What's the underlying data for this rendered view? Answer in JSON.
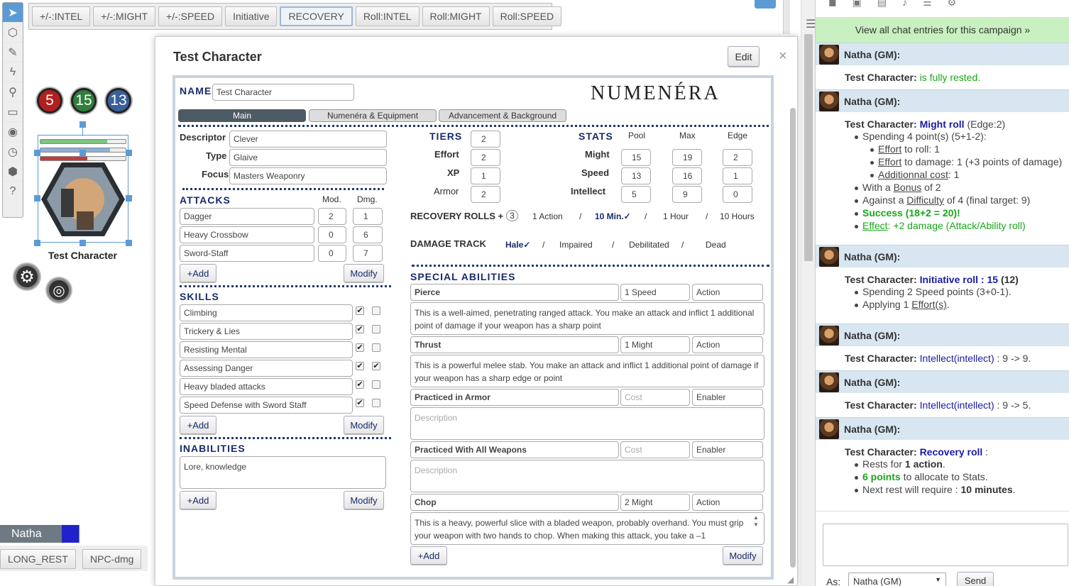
{
  "macros": [
    "+/-:INTEL",
    "+/-:MIGHT",
    "+/-:SPEED",
    "Initiative",
    "RECOVERY",
    "Roll:INTEL",
    "Roll:MIGHT",
    "Roll:SPEED"
  ],
  "token": {
    "bubble1": "5",
    "bubble2": "15",
    "bubble3": "13",
    "name": "Test Character",
    "bar1_fill": 0.78,
    "bar2_fill": 0.82,
    "bar3_fill": 0.55,
    "bar1_color": "#7fc47f",
    "bar2_color": "#8cb0d8",
    "bar3_color": "#c33c3c"
  },
  "player": {
    "name": "Natha",
    "color": "#2222cc"
  },
  "bottom_macros": [
    "LONG_REST",
    "NPC-dmg"
  ],
  "sheet": {
    "title": "Test Character",
    "edit": "Edit",
    "close": "×",
    "logo": "NUMENÉRA",
    "name_label": "NAME",
    "name_value": "Test Character",
    "tabs": [
      "Main",
      "Numenéra & Equipment",
      "Advancement & Background"
    ],
    "descriptor_label": "Descriptor",
    "descriptor": "Clever",
    "type_label": "Type",
    "type": "Glaive",
    "focus_label": "Focus",
    "focus": "Masters Weaponry",
    "tiers_label": "TIERS",
    "tiers": "2",
    "effort_label": "Effort",
    "effort": "2",
    "xp_label": "XP",
    "xp": "1",
    "armor_label": "Armor",
    "armor": "2",
    "stats_label": "STATS",
    "pool_label": "Pool",
    "max_label": "Max",
    "edge_label": "Edge",
    "might_label": "Might",
    "might": {
      "pool": "15",
      "max": "19",
      "edge": "2"
    },
    "speed_label": "Speed",
    "speed": {
      "pool": "13",
      "max": "16",
      "edge": "1"
    },
    "intellect_label": "Intellect",
    "intellect": {
      "pool": "5",
      "max": "9",
      "edge": "0"
    },
    "attacks_label": "ATTACKS",
    "mod_label": "Mod.",
    "dmg_label": "Dmg.",
    "attacks": [
      {
        "name": "Dagger",
        "mod": "2",
        "dmg": "1"
      },
      {
        "name": "Heavy Crossbow",
        "mod": "0",
        "dmg": "6"
      },
      {
        "name": "Sword-Staff",
        "mod": "0",
        "dmg": "7"
      }
    ],
    "add_label": "+Add",
    "modify_label": "Modify",
    "skills_label": "SKILLS",
    "skills": [
      {
        "name": "Climbing",
        "trained": "✔",
        "specialized": ""
      },
      {
        "name": "Trickery & Lies",
        "trained": "✔",
        "specialized": ""
      },
      {
        "name": "Resisting Mental",
        "trained": "✔",
        "specialized": ""
      },
      {
        "name": "Assessing Danger",
        "trained": "✔",
        "specialized": "✔"
      },
      {
        "name": "Heavy bladed attacks",
        "trained": "✔",
        "specialized": ""
      },
      {
        "name": "Speed Defense with Sword Staff",
        "trained": "✔",
        "specialized": ""
      }
    ],
    "inabilities_label": "INABILITIES",
    "inabilities": "Lore, knowledge",
    "recovery_label": "RECOVERY ROLLS +",
    "recovery_bonus": "3",
    "recovery": [
      "1 Action",
      "/",
      "10 Min.✓",
      "/",
      "1 Hour",
      "/",
      "10 Hours"
    ],
    "damage_label": "DAMAGE TRACK",
    "damage": [
      "Hale✓",
      "/",
      "Impaired",
      "/",
      "Debilitated",
      "/",
      "Dead"
    ],
    "special_label": "SPECIAL ABILITIES",
    "abilities": [
      {
        "name": "Pierce",
        "cost": "1 Speed",
        "type": "Action",
        "desc": "This is a well-aimed, penetrating ranged attack. You make an attack and inflict 1 additional point of damage if your weapon has a sharp point"
      },
      {
        "name": "Thrust",
        "cost": "1 Might",
        "type": "Action",
        "desc": "This is a powerful melee stab. You make an attack and inflict 1 additional point of damage if your weapon has a sharp edge or point"
      },
      {
        "name": "Practiced in Armor",
        "cost": "",
        "type": "Enabler",
        "desc": ""
      },
      {
        "name": "Practiced With All Weapons",
        "cost": "",
        "type": "Enabler",
        "desc": ""
      },
      {
        "name": "Chop",
        "cost": "2 Might",
        "type": "Action",
        "desc": "This is a heavy, powerful  slice with a bladed weapon, probably overhand.  You must grip your weapon with two hands  to chop. When making this attack, you take a  –1"
      }
    ],
    "cost_placeholder": "Cost",
    "desc_placeholder": "Description"
  },
  "chat": {
    "view_all": "View all chat entries for this campaign »",
    "sender": "Natha (GM):",
    "speaker": "Test Character:",
    "m1": "is fully rested.",
    "m2_roll": "Might roll",
    "m2_edge": "(Edge:2)",
    "m2_l1": "Spending 4 point(s) (5+1-2):",
    "effort": "Effort",
    "m2_l2": "to roll: 1",
    "m2_l3": "to damage: 1 (+3 points of damage)",
    "addcost": "Additionnal cost",
    "m2_l4": ": 1",
    "m2_l5a": "With a",
    "bonus": "Bonus",
    "m2_l5b": "of 2",
    "m2_l6a": "Against a",
    "difficulty": "Difficulty",
    "m2_l6b": "of 4 (final target: 9)",
    "m2_success": "Success (18+2 = 20)!",
    "effect": "Effect",
    "m2_l8": ": +2 damage (Attack/Ability roll)",
    "m3_roll": "Initiative roll : 15",
    "m3_val": "(12)",
    "m3_l1": "Spending 2 Speed points (3+0-1).",
    "m3_l2a": "Applying 1",
    "efforts": "Effort(s)",
    "m3_l2b": ".",
    "m4_stat": "Intellect(intellect)",
    "m4_val": ": 9 -> 9.",
    "m5_stat": "Intellect(intellect)",
    "m5_val": ": 9 -> 5.",
    "m6_roll": "Recovery roll",
    "m6_colon": ":",
    "m6_l1a": "Rests for",
    "m6_l1b": "1 action",
    "m6_l1c": ".",
    "m6_l2a": "6 points",
    "m6_l2b": "to allocate to Stats.",
    "m6_l3a": "Next rest will require :",
    "m6_l3b": "10 minutes",
    "m6_l3c": ".",
    "as_label": "As:",
    "as_value": "Natha (GM)",
    "send": "Send"
  }
}
